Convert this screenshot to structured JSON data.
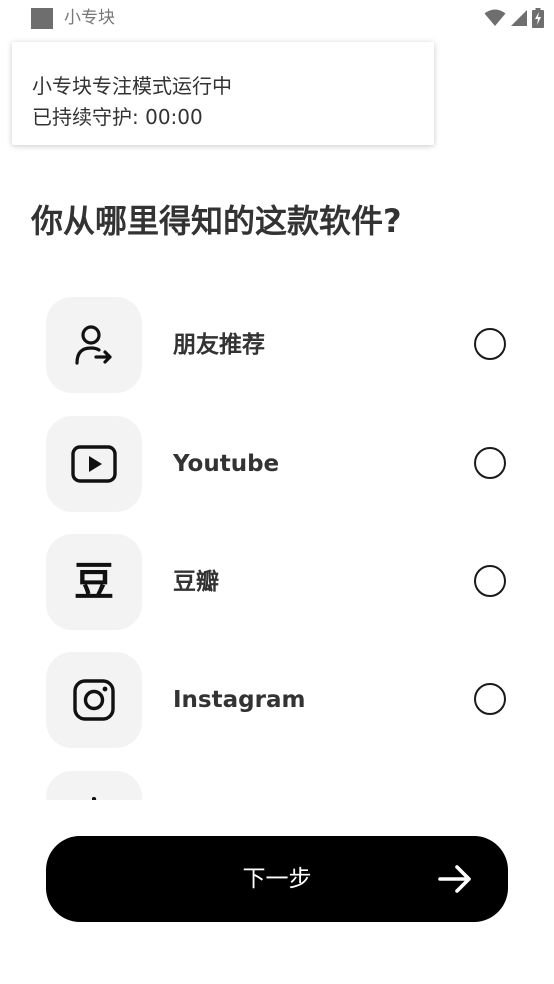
{
  "status_bar": {
    "app_name": "小专块"
  },
  "toast": {
    "line1": "小专块专注模式运行中",
    "line2": "已持续守护: 00:00"
  },
  "question": "你从哪里得知的这款软件?",
  "options": [
    {
      "label": "朋友推荐",
      "icon": "user-share-icon",
      "selected": false
    },
    {
      "label": "Youtube",
      "icon": "youtube-icon",
      "selected": false
    },
    {
      "label": "豆瓣",
      "icon": "douban-icon",
      "icon_text": "豆",
      "selected": false
    },
    {
      "label": "Instagram",
      "icon": "instagram-icon",
      "selected": false
    },
    {
      "label": "",
      "icon": "tiktok-icon",
      "selected": false
    }
  ],
  "next_button": {
    "label": "下一步",
    "icon": "arrow-right-icon"
  },
  "colors": {
    "background": "#ffffff",
    "icon_tile": "#f3f3f3",
    "button": "#000000",
    "button_text": "#ffffff",
    "text": "#333333"
  }
}
